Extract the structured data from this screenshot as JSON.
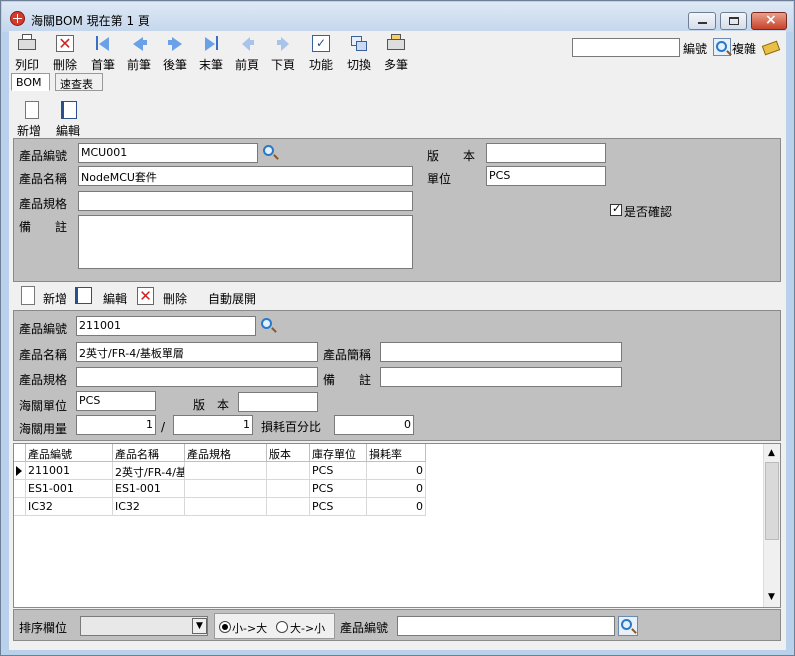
{
  "window": {
    "title": "海關BOM  現在第 1 頁"
  },
  "toolbar": {
    "print": "列印",
    "delete": "刪除",
    "first": "首筆",
    "prev": "前筆",
    "next": "後筆",
    "last": "末筆",
    "prev_page": "前頁",
    "next_page": "下頁",
    "func": "功能",
    "switch": "切換",
    "multi": "多筆"
  },
  "search": {
    "value": "",
    "code_label": "編號",
    "complex_label": "複雜"
  },
  "tabs": {
    "bom": "BOM",
    "quick": "速查表"
  },
  "header_actions": {
    "add": "新增",
    "edit": "編輯"
  },
  "master": {
    "code_label": "產品編號",
    "code_value": "MCU001",
    "name_label": "產品名稱",
    "name_value": "NodeMCU套件",
    "spec_label": "產品規格",
    "spec_value": "",
    "note_label": "備　　註",
    "note_value": "",
    "version_label": "版　　本",
    "version_value": "",
    "unit_label": "單位",
    "unit_value": "PCS",
    "confirm_label": "是否確認",
    "confirmed": true
  },
  "detail_actions": {
    "add": "新增",
    "edit": "編輯",
    "delete": "刪除",
    "auto_expand": "自動展開"
  },
  "detail": {
    "code_label": "產品編號",
    "code_value": "211001",
    "name_label": "產品名稱",
    "name_value": "2英寸/FR-4/基板單層",
    "short_label": "產品簡稱",
    "short_value": "",
    "spec_label": "產品規格",
    "spec_value": "",
    "note_label": "備　　註",
    "note_value": "",
    "customs_unit_label": "海關單位",
    "customs_unit_value": "PCS",
    "version_label": "版　本",
    "version_value": "",
    "customs_qty_label": "海關用量",
    "qty_a": "1",
    "qty_sep": "/",
    "qty_b": "1",
    "loss_label": "損耗百分比",
    "loss_value": "0"
  },
  "grid": {
    "columns": [
      "產品編號",
      "產品名稱",
      "產品規格",
      "版本",
      "庫存單位",
      "損耗率"
    ],
    "rows": [
      [
        "211001",
        "2英寸/FR-4/基",
        "",
        "",
        "PCS",
        "0"
      ],
      [
        "ES1-001",
        "ES1-001",
        "",
        "",
        "PCS",
        "0"
      ],
      [
        "IC32",
        "IC32",
        "",
        "",
        "PCS",
        "0"
      ]
    ]
  },
  "footer": {
    "sort_label": "排序欄位",
    "sort_value": "",
    "asc": "小->大",
    "desc": "大->小",
    "code_label": "產品編號",
    "code_value": ""
  }
}
